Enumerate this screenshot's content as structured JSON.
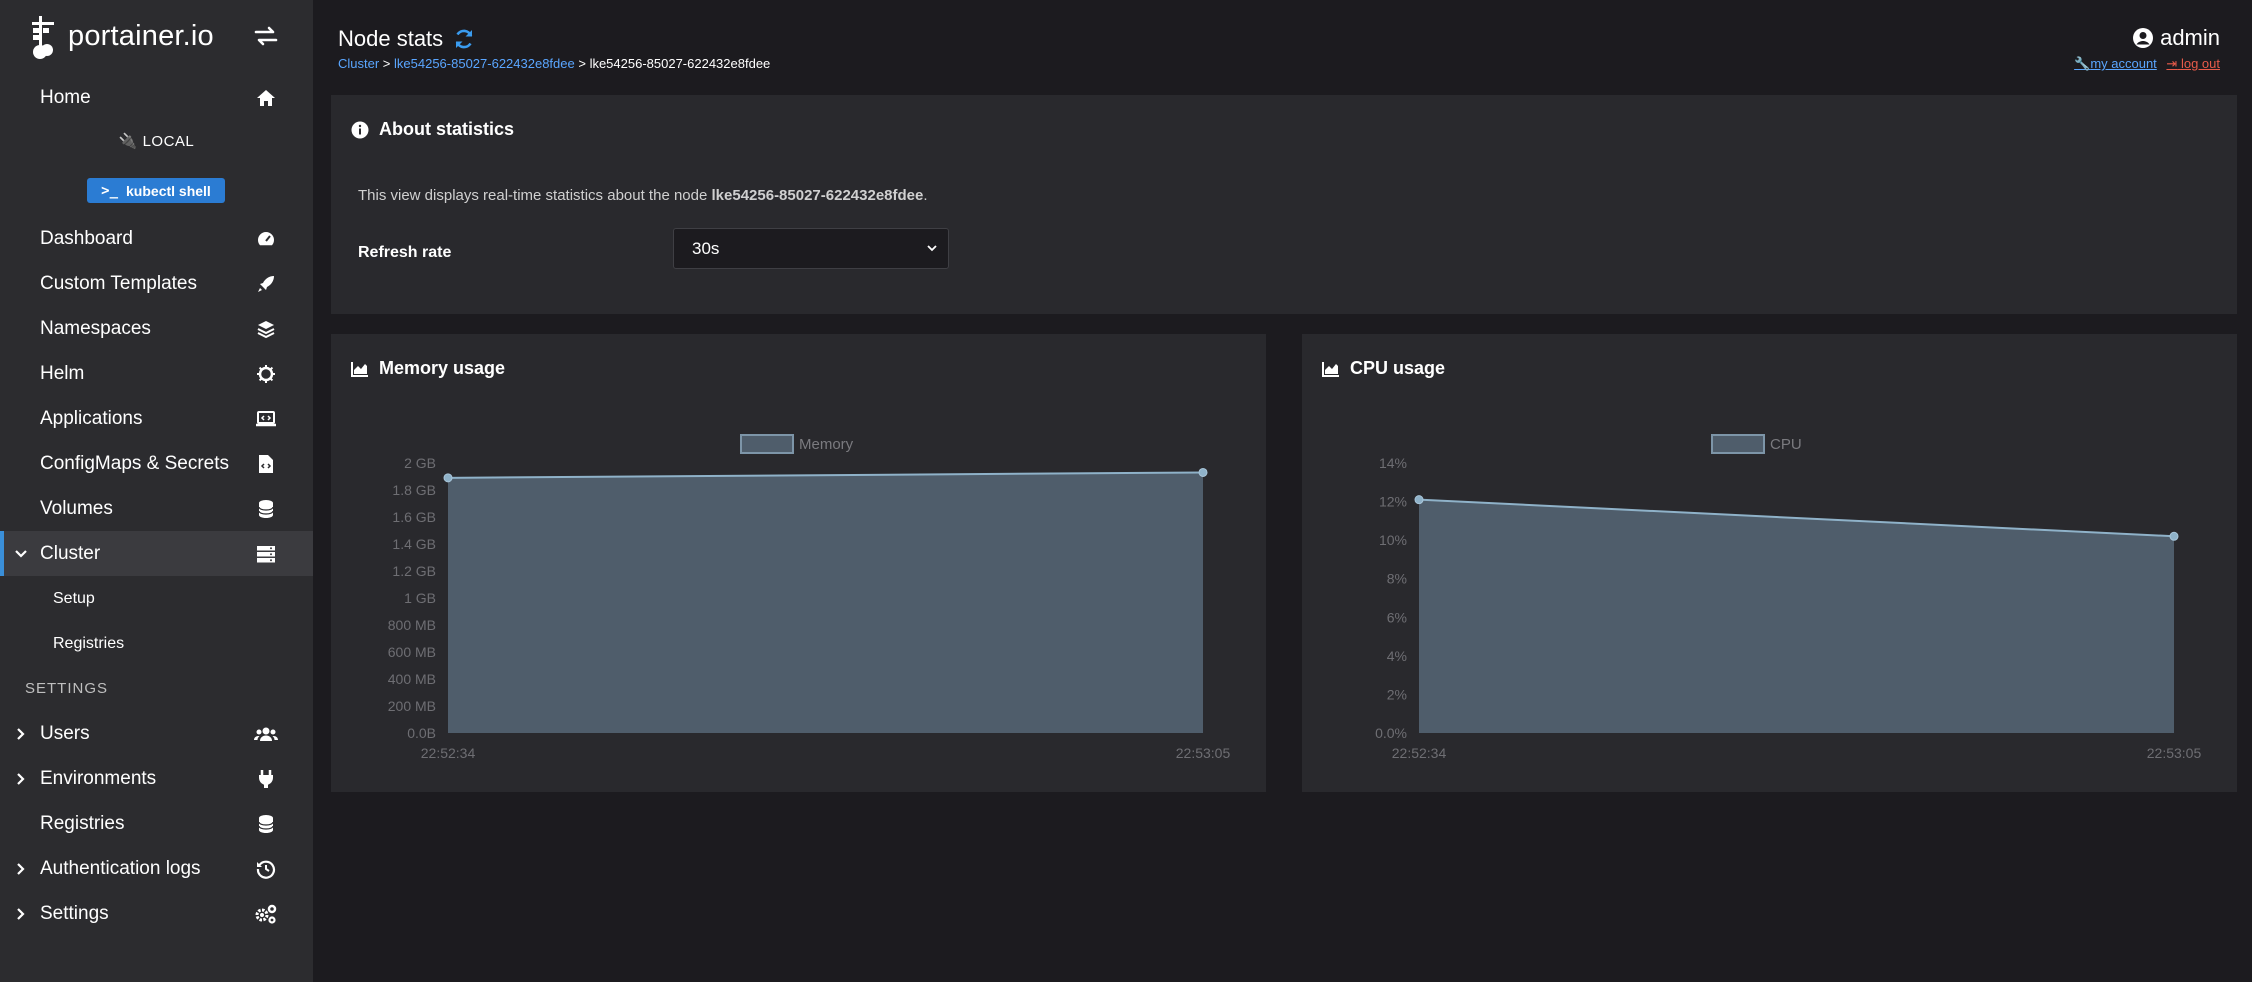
{
  "app": {
    "logo_text": "portainer.io"
  },
  "sidebar": {
    "env_name": "LOCAL",
    "kubectl_label": "kubectl shell",
    "settings_section": "SETTINGS",
    "items": {
      "home": "Home",
      "dashboard": "Dashboard",
      "custom_templates": "Custom Templates",
      "namespaces": "Namespaces",
      "helm": "Helm",
      "applications": "Applications",
      "configmaps": "ConfigMaps & Secrets",
      "volumes": "Volumes",
      "cluster": "Cluster",
      "setup": "Setup",
      "registries_sub": "Registries",
      "users": "Users",
      "environments": "Environments",
      "registries": "Registries",
      "auth_logs": "Authentication logs",
      "settings": "Settings"
    }
  },
  "header": {
    "title": "Node stats",
    "breadcrumb": {
      "cluster": "Cluster",
      "sep1": " > ",
      "node_link": "lke54256-85027-622432e8fdee",
      "sep2": " > ",
      "current": "lke54256-85027-622432e8fdee"
    },
    "user": "admin",
    "my_account": "my account",
    "log_out": "log out"
  },
  "about": {
    "title": "About statistics",
    "text_prefix": "This view displays real-time statistics about the node ",
    "node_name": "lke54256-85027-622432e8fdee",
    "text_suffix": ".",
    "refresh_label": "Refresh rate",
    "refresh_value": "30s"
  },
  "colors": {
    "accent": "#2b7cd3",
    "link": "#5aa6ff",
    "logout": "#e85b4a",
    "chart_fill": "#4f5d6b",
    "chart_line": "#8fb2c9"
  },
  "chart_data": [
    {
      "type": "area",
      "title": "Memory usage",
      "legend": [
        "Memory"
      ],
      "legend_position": "top-center",
      "x": [
        "22:52:34",
        "22:53:05"
      ],
      "series": [
        {
          "name": "Memory",
          "values": [
            1.89,
            1.93
          ]
        }
      ],
      "y_unit": "GB",
      "ylim": [
        0,
        2
      ],
      "y_ticks": [
        "0.0B",
        "200 MB",
        "400 MB",
        "600 MB",
        "800 MB",
        "1 GB",
        "1.2 GB",
        "1.4 GB",
        "1.6 GB",
        "1.8 GB",
        "2 GB"
      ],
      "y_tick_values": [
        0,
        0.2,
        0.4,
        0.6,
        0.8,
        1.0,
        1.2,
        1.4,
        1.6,
        1.8,
        2.0
      ]
    },
    {
      "type": "area",
      "title": "CPU usage",
      "legend": [
        "CPU"
      ],
      "legend_position": "top-center",
      "x": [
        "22:52:34",
        "22:53:05"
      ],
      "series": [
        {
          "name": "CPU",
          "values": [
            12.1,
            10.2
          ]
        }
      ],
      "y_unit": "%",
      "ylim": [
        0,
        14
      ],
      "y_ticks": [
        "0.0%",
        "2%",
        "4%",
        "6%",
        "8%",
        "10%",
        "12%",
        "14%"
      ],
      "y_tick_values": [
        0,
        2,
        4,
        6,
        8,
        10,
        12,
        14
      ]
    }
  ]
}
